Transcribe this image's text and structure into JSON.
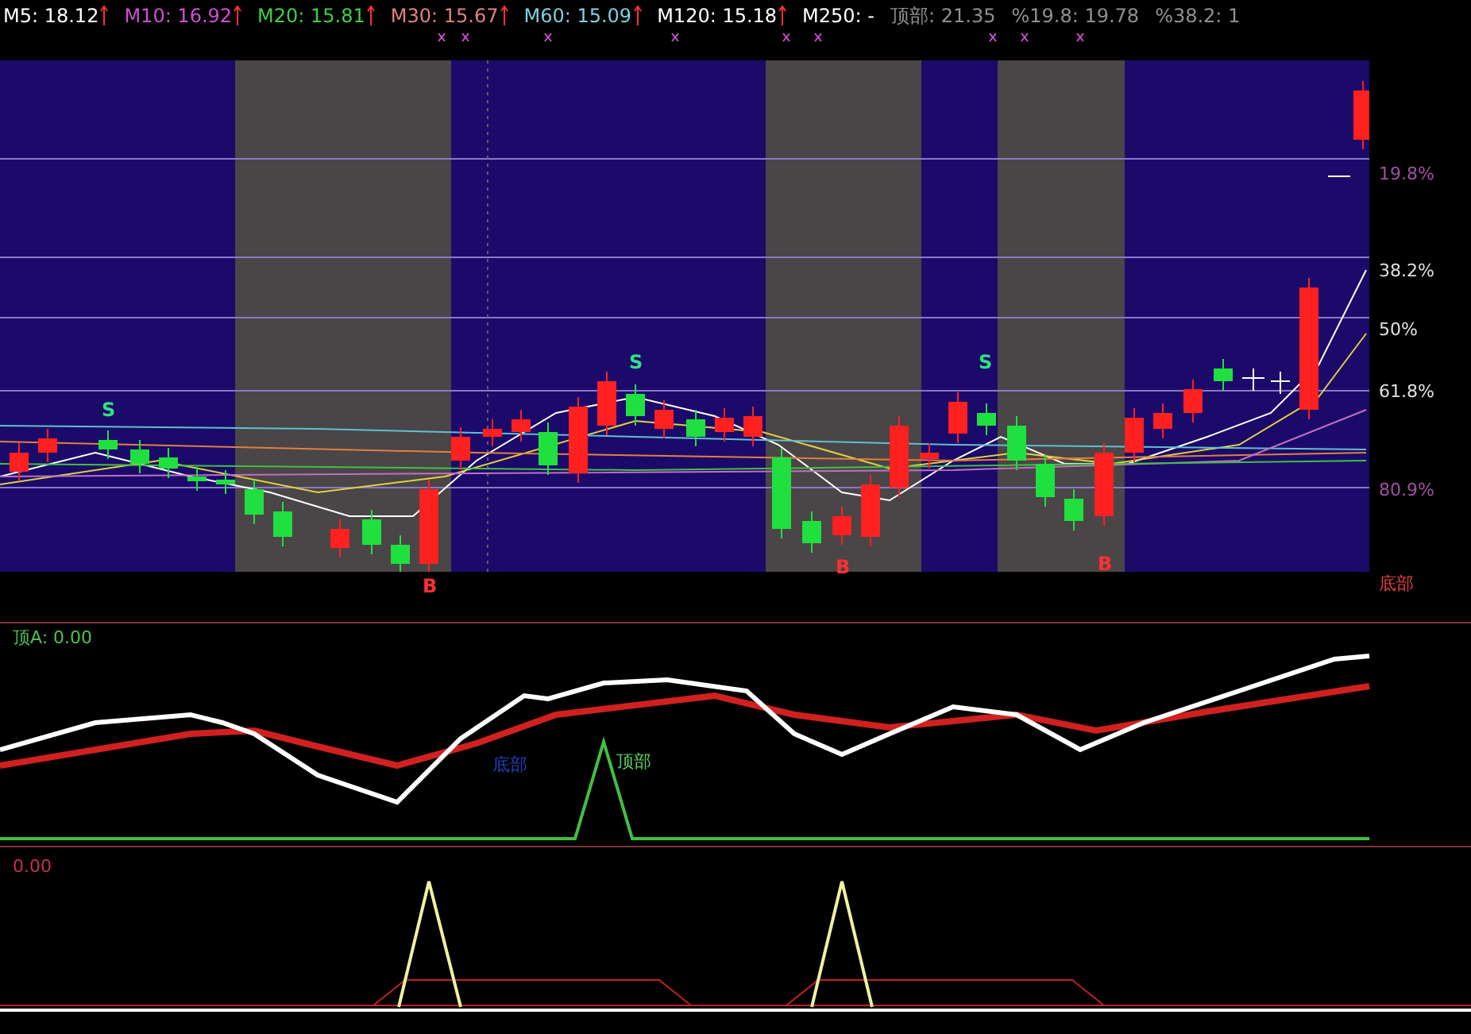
{
  "indicators": [
    {
      "label": "M5: 18.12",
      "color": "#ffffff",
      "arrow": true
    },
    {
      "label": "M10: 16.92",
      "color": "#d050d0",
      "arrow": true
    },
    {
      "label": "M20: 15.81",
      "color": "#40d040",
      "arrow": true
    },
    {
      "label": "M30: 15.67",
      "color": "#e08080",
      "arrow": true
    },
    {
      "label": "M60: 15.09",
      "color": "#80d0e0",
      "arrow": true
    },
    {
      "label": "M120: 15.18",
      "color": "#ffffff",
      "arrow": true
    },
    {
      "label": "M250: -",
      "color": "#ffffff",
      "arrow": false
    },
    {
      "label": "顶部: 21.35",
      "color": "#909090",
      "arrow": false
    },
    {
      "label": "%19.8: 19.78",
      "color": "#909090",
      "arrow": false
    },
    {
      "label": "%38.2: 1",
      "color": "#909090",
      "arrow": false
    }
  ],
  "price_chart": {
    "signals": [
      {
        "text": "S",
        "kind": "sell"
      },
      {
        "text": "S",
        "kind": "sell"
      },
      {
        "text": "S",
        "kind": "sell"
      },
      {
        "text": "B",
        "kind": "buy"
      },
      {
        "text": "B",
        "kind": "buy"
      },
      {
        "text": "B",
        "kind": "buy"
      }
    ],
    "fib_levels": [
      {
        "label": "19.8%"
      },
      {
        "label": "38.2%"
      },
      {
        "label": "50%"
      },
      {
        "label": "61.8%"
      },
      {
        "label": "80.9%"
      }
    ],
    "bottom_label": "底部"
  },
  "oscillator": {
    "title": "顶A: 0.00",
    "labels": [
      {
        "text": "底部",
        "kind": "bottom"
      },
      {
        "text": "顶部",
        "kind": "top"
      }
    ]
  },
  "signal_panel": {
    "title": "0.00"
  }
}
